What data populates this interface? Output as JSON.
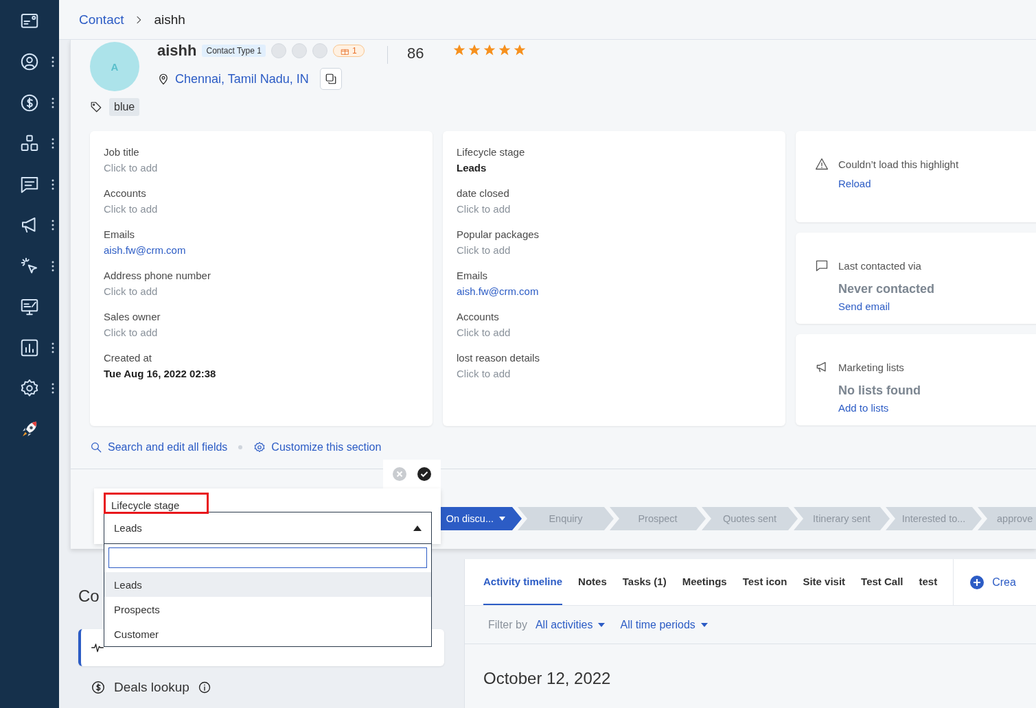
{
  "sidebar": {
    "items": [
      {
        "kind": "dashboard",
        "has_menu": false
      },
      {
        "kind": "contacts",
        "has_menu": true
      },
      {
        "kind": "deals",
        "has_menu": true
      },
      {
        "kind": "products",
        "has_menu": true
      },
      {
        "kind": "chat",
        "has_menu": true
      },
      {
        "kind": "campaigns",
        "has_menu": true
      },
      {
        "kind": "automation",
        "has_menu": true
      },
      {
        "kind": "display",
        "has_menu": false
      },
      {
        "kind": "reports",
        "has_menu": true
      },
      {
        "kind": "settings",
        "has_menu": true
      },
      {
        "kind": "rocket",
        "has_menu": false
      }
    ]
  },
  "breadcrumb": {
    "parent": "Contact",
    "current": "aishh"
  },
  "contact": {
    "avatar_initial": "A",
    "name": "aishh",
    "type_badge": "Contact Type 1",
    "alerts_count": "1",
    "score": "86",
    "stars": 5,
    "location": "Chennai, Tamil Nadu, IN",
    "tags": [
      "blue"
    ]
  },
  "fields_left": [
    {
      "label": "Job title",
      "value": "Click to add",
      "kind": "empty"
    },
    {
      "label": "Accounts",
      "value": "Click to add",
      "kind": "empty"
    },
    {
      "label": "Emails",
      "value": "aish.fw@crm.com",
      "kind": "link"
    },
    {
      "label": "Address phone number",
      "value": "Click to add",
      "kind": "empty"
    },
    {
      "label": "Sales owner",
      "value": "Click to add",
      "kind": "empty"
    },
    {
      "label": "Created at",
      "value": "Tue Aug 16, 2022 02:38",
      "kind": "text"
    }
  ],
  "fields_middle": [
    {
      "label": "Lifecycle stage",
      "value": "Leads",
      "kind": "text"
    },
    {
      "label": "date closed",
      "value": "Click to add",
      "kind": "empty"
    },
    {
      "label": "Popular packages",
      "value": "Click to add",
      "kind": "empty"
    },
    {
      "label": "Emails",
      "value": "aish.fw@crm.com",
      "kind": "link"
    },
    {
      "label": "Accounts",
      "value": "Click to add",
      "kind": "empty"
    },
    {
      "label": "lost reason details",
      "value": "Click to add",
      "kind": "empty"
    }
  ],
  "highlights": [
    {
      "kind": "error",
      "title": "Couldn’t load this highlight",
      "action": "Reload"
    },
    {
      "kind": "contact",
      "title": "Last contacted via",
      "status": "Never contacted",
      "action": "Send email"
    },
    {
      "kind": "lists",
      "title": "Marketing lists",
      "status": "No lists found",
      "action": "Add to lists"
    }
  ],
  "section_links": [
    {
      "kind": "search",
      "label": "Search and edit all fields"
    },
    {
      "kind": "customize",
      "label": "Customize this section"
    }
  ],
  "lifecycle_stages": [
    {
      "label": "On discu...",
      "selected": true
    },
    {
      "label": "Enquiry",
      "selected": false
    },
    {
      "label": "Prospect",
      "selected": false
    },
    {
      "label": "Quotes sent",
      "selected": false
    },
    {
      "label": "Itinerary sent",
      "selected": false
    },
    {
      "label": "Interested to...",
      "selected": false
    },
    {
      "label": "approve",
      "selected": false
    }
  ],
  "lifecycle_editor": {
    "label": "Lifecycle stage",
    "value": "Leads",
    "expanded": true,
    "options": [
      {
        "label": "Leads",
        "selected": true
      },
      {
        "label": "Prospects",
        "selected": false
      },
      {
        "label": "Customer",
        "selected": false
      }
    ]
  },
  "left_section": {
    "heading": "Co",
    "lookups": [
      {
        "label": "Deals lookup"
      }
    ]
  },
  "activity": {
    "tabs": [
      {
        "label": "Activity timeline",
        "selected": true
      },
      {
        "label": "Notes",
        "selected": false
      },
      {
        "label": "Tasks (1)",
        "selected": false
      },
      {
        "label": "Meetings",
        "selected": false
      },
      {
        "label": "Test icon",
        "selected": false
      },
      {
        "label": "Site visit",
        "selected": false
      },
      {
        "label": "Test Call",
        "selected": false
      },
      {
        "label": "test",
        "selected": false
      }
    ],
    "create_label": "Crea",
    "filter_label": "Filter by",
    "filters": [
      "All activities",
      "All time periods"
    ],
    "date": "October 12, 2022"
  }
}
